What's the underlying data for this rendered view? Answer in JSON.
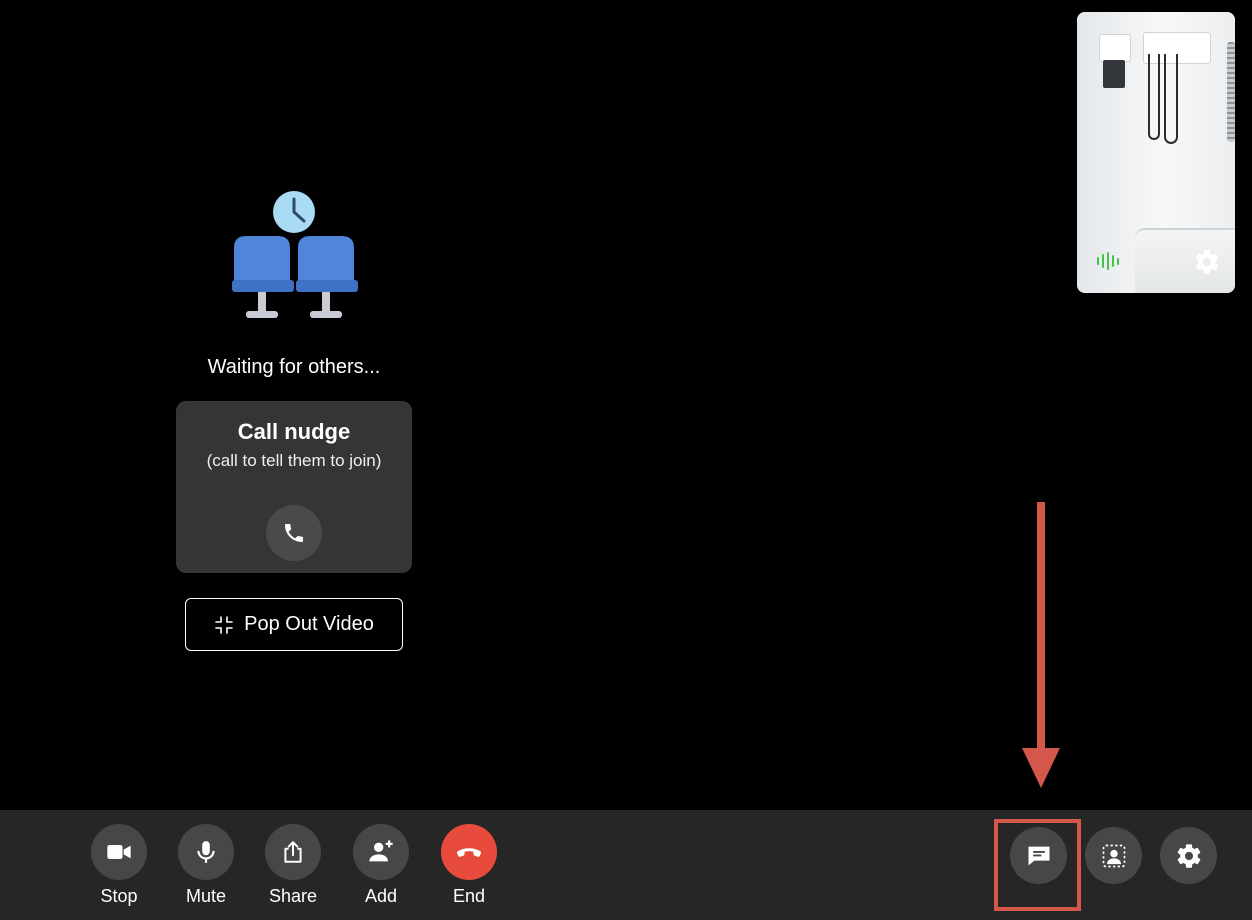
{
  "waiting": {
    "message": "Waiting for others..."
  },
  "nudge": {
    "title": "Call nudge",
    "subtitle": "(call to tell them to join)"
  },
  "popout": {
    "label": "Pop Out Video"
  },
  "controls": {
    "stop": "Stop",
    "mute": "Mute",
    "share": "Share",
    "add": "Add",
    "end": "End"
  },
  "right_controls": [
    "chat-icon",
    "participants-icon",
    "settings-icon"
  ],
  "colors": {
    "background": "#000000",
    "bar": "#262626",
    "button": "#474747",
    "end": "#e84b3c",
    "annotation": "#d3574a",
    "chair": "#4f86d9",
    "clock": "#a9dcf4",
    "meter": "#46c24c"
  }
}
